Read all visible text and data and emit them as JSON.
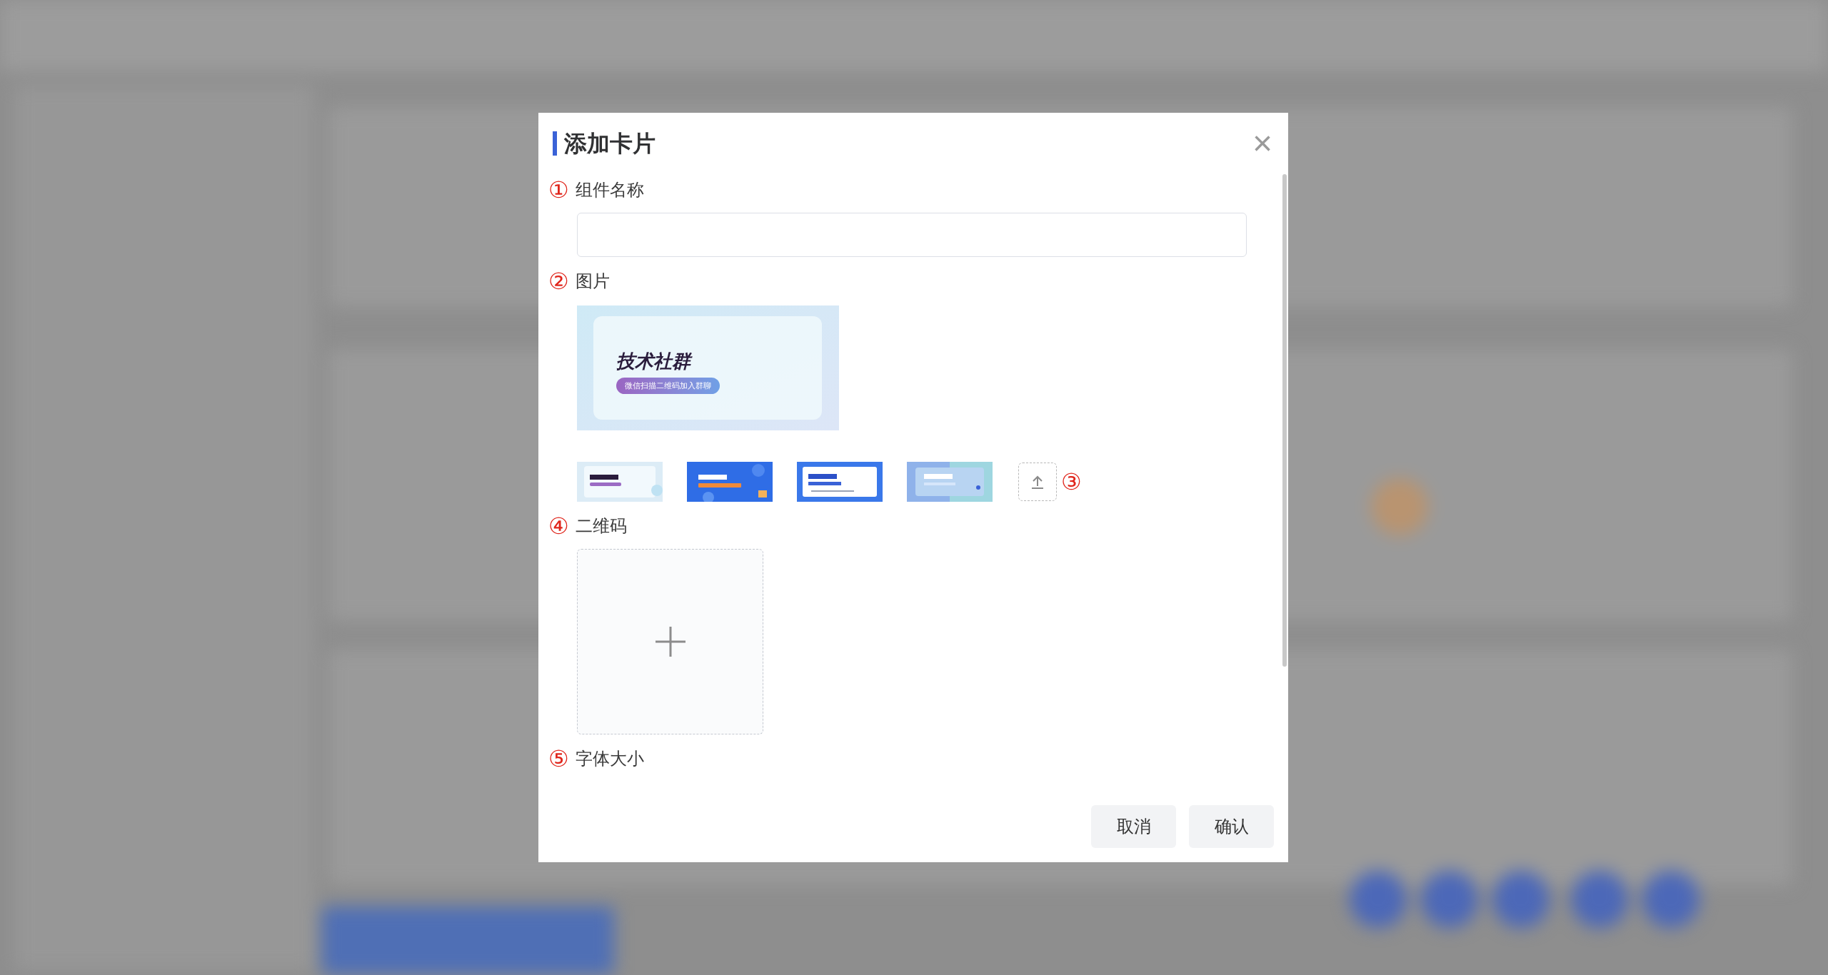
{
  "dialog": {
    "title": "添加卡片",
    "close": "×"
  },
  "fields": [
    {
      "kind": "input",
      "marker": "①",
      "label": "组件名称"
    },
    {
      "marker": "②",
      "label": "图片",
      "preview": {
        "title": "技术社群",
        "subtitle": "微信扫描二维码加入群聊"
      },
      "thumbnails": [
        {
          "kind": "light"
        },
        {
          "kind": "blue"
        },
        {
          "kind": "framed"
        },
        {
          "kind": "gradient"
        }
      ],
      "upload_marker": "③"
    },
    {
      "kind": "upload",
      "marker": "④",
      "label": "二维码"
    },
    {
      "kind": "label",
      "marker": "⑤",
      "label": "字体大小"
    }
  ],
  "buttons": [
    "取消",
    "确认"
  ]
}
